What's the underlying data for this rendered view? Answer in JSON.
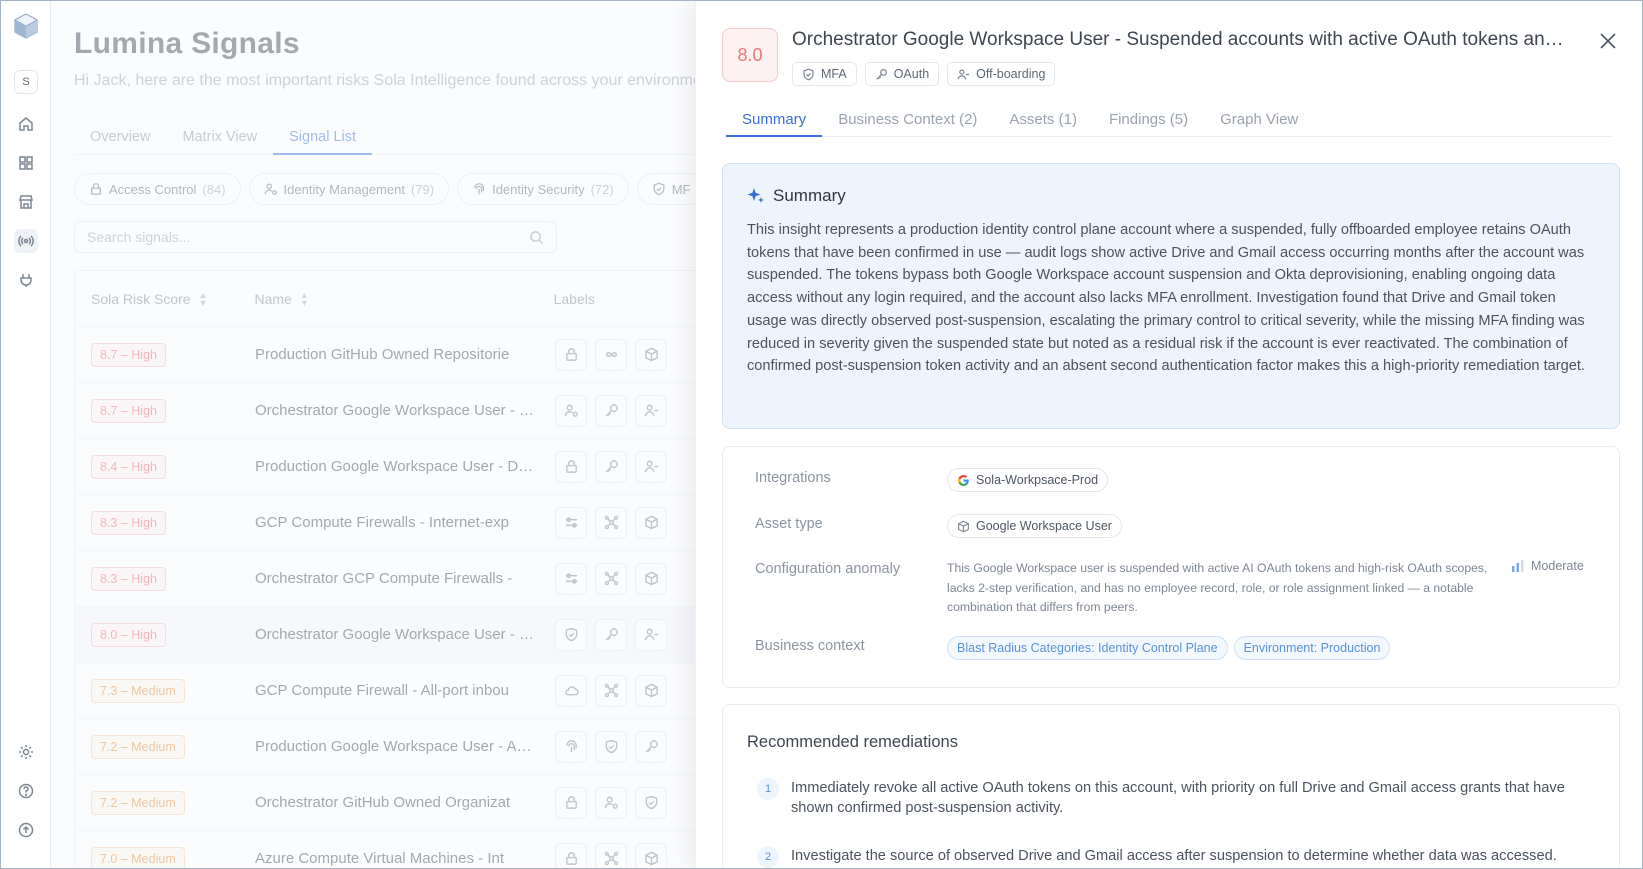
{
  "app": {
    "title": "Lumina Signals",
    "subtitle": "Hi Jack, here are the most important risks Sola Intelligence found across your environment",
    "workspace_initial": "S"
  },
  "main_tabs": [
    {
      "label": "Overview"
    },
    {
      "label": "Matrix View"
    },
    {
      "label": "Signal List",
      "active": true
    }
  ],
  "categories": [
    {
      "label": "Access Control",
      "count": "(84)",
      "icon": "lock-icon"
    },
    {
      "label": "Identity Management",
      "count": "(79)",
      "icon": "user-gear-icon"
    },
    {
      "label": "Identity Security",
      "count": "(72)",
      "icon": "fingerprint-icon"
    },
    {
      "label": "MF",
      "count": "",
      "icon": "shield-icon"
    }
  ],
  "search": {
    "placeholder": "Search signals..."
  },
  "table": {
    "headers": {
      "score": "Sola Risk Score",
      "name": "Name",
      "labels": "Labels"
    },
    "rows": [
      {
        "score": "8.7",
        "level": "High",
        "name": "Production GitHub Owned Repositorie",
        "labels": [
          "lock-icon",
          "infinity-icon",
          "box-gear-icon"
        ]
      },
      {
        "score": "8.7",
        "level": "High",
        "name": "Orchestrator Google Workspace User - Suspended",
        "labels": [
          "user-gear-icon",
          "key-icon",
          "user-minus-icon"
        ]
      },
      {
        "score": "8.4",
        "level": "High",
        "name": "Production Google Workspace User - Dormant",
        "labels": [
          "lock-icon",
          "key-icon",
          "user-minus-icon"
        ]
      },
      {
        "score": "8.3",
        "level": "High",
        "name": "GCP Compute Firewalls - Internet-exp",
        "labels": [
          "sliders-icon",
          "network-icon",
          "box-gear-icon"
        ]
      },
      {
        "score": "8.3",
        "level": "High",
        "name": "Orchestrator GCP Compute Firewalls - ",
        "labels": [
          "sliders-icon",
          "network-icon",
          "box-gear-icon"
        ]
      },
      {
        "score": "8.0",
        "level": "High",
        "name": "Orchestrator Google Workspace User - Suspended",
        "labels": [
          "shield-icon",
          "key-icon",
          "user-minus-icon"
        ],
        "selected": true
      },
      {
        "score": "7.3",
        "level": "Medium",
        "name": "GCP Compute Firewall - All-port inbou",
        "labels": [
          "cloud-icon",
          "network-icon",
          "box-gear-icon"
        ]
      },
      {
        "score": "7.2",
        "level": "Medium",
        "name": "Production Google Workspace User - Admin",
        "labels": [
          "fingerprint-icon",
          "shield-icon",
          "key-icon"
        ]
      },
      {
        "score": "7.2",
        "level": "Medium",
        "name": "Orchestrator GitHub Owned Organizat",
        "labels": [
          "lock-icon",
          "user-gear-icon",
          "shield-icon"
        ]
      },
      {
        "score": "7.0",
        "level": "Medium",
        "name": "Azure Compute Virtual Machines - Int",
        "labels": [
          "lock-icon",
          "network-icon",
          "box-gear-icon"
        ]
      }
    ]
  },
  "drawer": {
    "score": "8.0",
    "title": "Orchestrator Google Workspace User - Suspended accounts with active OAuth tokens and no MFA",
    "tags": [
      {
        "label": "MFA",
        "icon": "shield-icon"
      },
      {
        "label": "OAuth",
        "icon": "key-icon"
      },
      {
        "label": "Off-boarding",
        "icon": "user-minus-icon"
      }
    ],
    "tabs": [
      {
        "label": "Summary",
        "active": true
      },
      {
        "label": "Business Context (2)"
      },
      {
        "label": "Assets (1)"
      },
      {
        "label": "Findings (5)"
      },
      {
        "label": "Graph View"
      }
    ],
    "summary": {
      "heading": "Summary",
      "text": "This insight represents a production identity control plane account where a suspended, fully offboarded employee retains OAuth tokens that have been confirmed in use — audit logs show active Drive and Gmail access occurring months after the account was suspended. The tokens bypass both Google Workspace account suspension and Okta deprovisioning, enabling ongoing data access without any login required, and the account also lacks MFA enrollment. Investigation found that Drive and Gmail token usage was directly observed post-suspension, escalating the primary control to critical severity, while the missing MFA finding was reduced in severity given the suspended state but noted as a residual risk if the account is ever reactivated. The combination of confirmed post-suspension token activity and an absent second authentication factor makes this a high-priority remediation target."
    },
    "details": {
      "integrations_label": "Integrations",
      "integration_value": "Sola-Workpsace-Prod",
      "asset_type_label": "Asset type",
      "asset_type_value": "Google Workspace User",
      "anomaly_label": "Configuration anomaly",
      "anomaly_text": "This Google Workspace user is suspended with active AI OAuth tokens and high-risk OAuth scopes, lacks 2-step verification, and has no employee record, role, or role assignment linked — a notable combination that differs from peers.",
      "anomaly_level": "Moderate",
      "business_label": "Business context",
      "business_tags": [
        "Blast Radius Categories: Identity Control Plane",
        "Environment: Production"
      ]
    },
    "remediations": {
      "title": "Recommended remediations",
      "items": [
        {
          "num": "1",
          "text": "Immediately revoke all active OAuth tokens on this account, with priority on full Drive and Gmail access grants that have shown confirmed post-suspension activity."
        },
        {
          "num": "2",
          "text": "Investigate the source of observed Drive and Gmail access after suspension to determine whether data was accessed."
        }
      ]
    }
  },
  "colors": {
    "accent": "#3b6fd6",
    "high": "#e86666",
    "medium": "#e08a34",
    "summary_bg": "#eef4fc"
  }
}
